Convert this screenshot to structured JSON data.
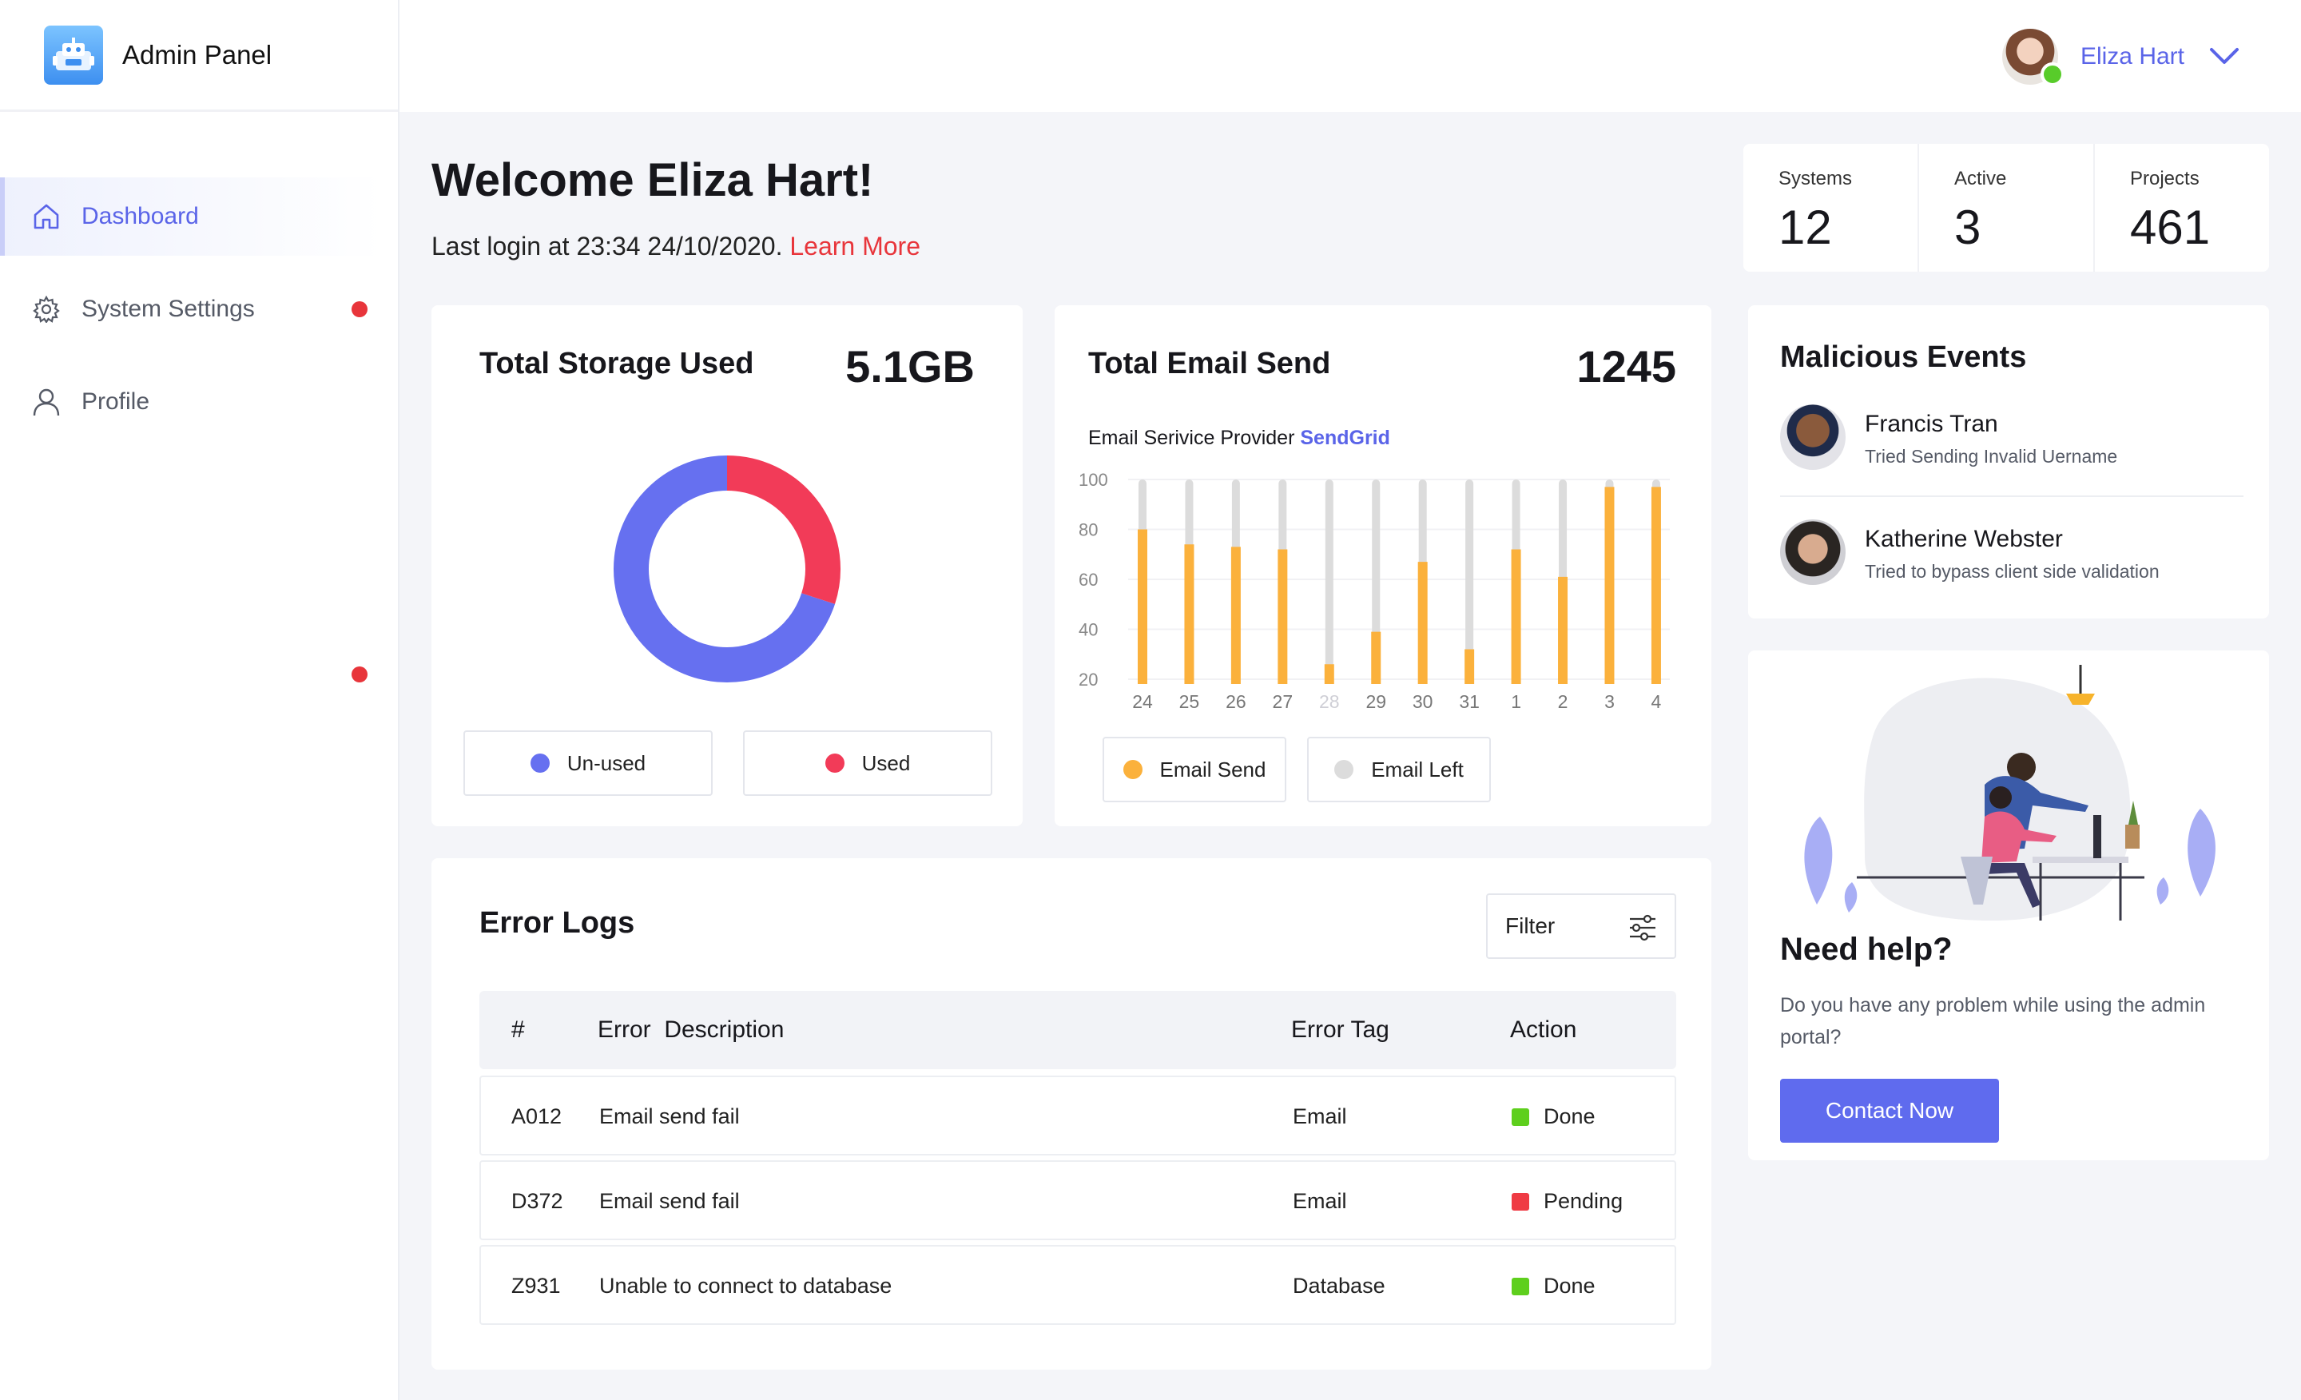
{
  "app": {
    "title": "Admin Panel",
    "logo_icon": "robot-logo-icon"
  },
  "sidebar": {
    "items": [
      {
        "label": "Dashboard",
        "icon": "home-icon",
        "active": true,
        "notification": false
      },
      {
        "label": "System Settings",
        "icon": "gear-icon",
        "active": false,
        "notification": true
      },
      {
        "label": "Profile",
        "icon": "user-icon",
        "active": false,
        "notification": false
      }
    ]
  },
  "header": {
    "user_name": "Eliza Hart",
    "online": true
  },
  "welcome": {
    "title": "Welcome Eliza Hart!",
    "last_login": "Last login at 23:34 24/10/2020.",
    "learn_more": "Learn More"
  },
  "stats": [
    {
      "label": "Systems",
      "value": "12"
    },
    {
      "label": "Active",
      "value": "3"
    },
    {
      "label": "Projects",
      "value": "461"
    }
  ],
  "storage": {
    "title": "Total Storage Used",
    "value": "5.1GB",
    "legend": [
      {
        "label": "Un-used",
        "color": "#6670f0"
      },
      {
        "label": "Used",
        "color": "#f23b58"
      }
    ]
  },
  "email": {
    "title": "Total Email Send",
    "value": "1245",
    "provider_label": "Email Serivice Provider",
    "provider_name": "SendGrid",
    "legend": [
      {
        "label": "Email Send",
        "color": "#fbb13c"
      },
      {
        "label": "Email Left",
        "color": "#dcdcdc"
      }
    ]
  },
  "chart_data": [
    {
      "type": "pie",
      "title": "Total Storage Used",
      "categories": [
        "Un-used",
        "Used"
      ],
      "values": [
        70,
        30
      ],
      "colors": [
        "#6670f0",
        "#f23b58"
      ]
    },
    {
      "type": "bar",
      "categories": [
        "24",
        "25",
        "26",
        "27",
        "28",
        "29",
        "30",
        "31",
        "1",
        "2",
        "3",
        "4"
      ],
      "categories_muted": [
        false,
        false,
        false,
        false,
        true,
        false,
        false,
        false,
        false,
        false,
        false,
        false
      ],
      "series": [
        {
          "name": "Email Send",
          "values": [
            80,
            74,
            73,
            72,
            26,
            39,
            67,
            32,
            72,
            61,
            97,
            97
          ],
          "color": "#fbb13c"
        },
        {
          "name": "Email Left",
          "values": [
            100,
            100,
            100,
            100,
            100,
            100,
            100,
            100,
            100,
            100,
            100,
            100
          ],
          "color": "#dcdcdc"
        }
      ],
      "yticks": [
        "100",
        "80",
        "60",
        "40",
        "20"
      ],
      "ylim": [
        20,
        100
      ],
      "grid": true
    }
  ],
  "error_logs": {
    "title": "Error Logs",
    "filter_label": "Filter",
    "columns": [
      "#",
      "Error  Description",
      "Error Tag",
      "Action"
    ],
    "rows": [
      {
        "id": "A012",
        "description": "Email send fail",
        "tag": "Email",
        "status": "Done",
        "status_color": "#5ecf1d"
      },
      {
        "id": "D372",
        "description": "Email send fail",
        "tag": "Email",
        "status": "Pending",
        "status_color": "#ef3b44"
      },
      {
        "id": "Z931",
        "description": "Unable to connect to database",
        "tag": "Database",
        "status": "Done",
        "status_color": "#5ecf1d"
      }
    ]
  },
  "malicious": {
    "title": "Malicious Events",
    "events": [
      {
        "name": "Francis Tran",
        "desc": "Tried Sending Invalid Uername"
      },
      {
        "name": "Katherine Webster",
        "desc": "Tried to bypass client side validation"
      }
    ]
  },
  "help": {
    "title": "Need help?",
    "text": "Do you have any problem while using the admin portal?",
    "button": "Contact Now"
  },
  "colors": {
    "accent": "#5f6bee",
    "danger": "#e8353b",
    "success": "#5ecf1d"
  }
}
